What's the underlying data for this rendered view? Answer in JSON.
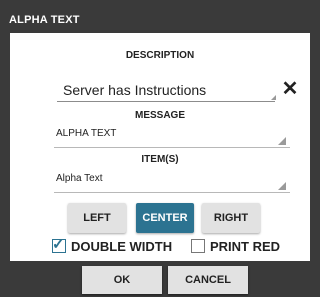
{
  "dialog": {
    "title": "ALPHA TEXT"
  },
  "description": {
    "label": "DESCRIPTION",
    "value": "Server has Instructions",
    "clear_icon": "close-icon"
  },
  "message": {
    "label": "MESSAGE",
    "selected": "ALPHA TEXT"
  },
  "items": {
    "label": "ITEM(S)",
    "selected": "Alpha Text"
  },
  "alignment": {
    "left_label": "LEFT",
    "center_label": "CENTER",
    "right_label": "RIGHT",
    "selected": "CENTER"
  },
  "options": {
    "double_width_label": "DOUBLE WIDTH",
    "double_width_checked": true,
    "print_red_label": "PRINT RED",
    "print_red_checked": false
  },
  "footer": {
    "ok_label": "OK",
    "cancel_label": "CANCEL"
  },
  "colors": {
    "accent": "#2c7391",
    "dialog_bg": "#3a3a3a",
    "panel_bg": "#ffffff"
  }
}
